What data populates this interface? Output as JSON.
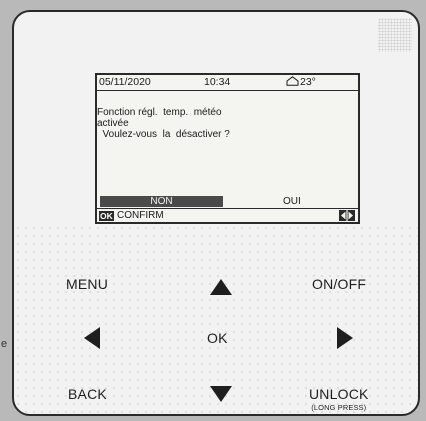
{
  "edge_text": "e",
  "lcd": {
    "status": {
      "date": "05/11/2020",
      "time": "10:34",
      "temperature": "23°"
    },
    "message": {
      "line1": "Fonction régl.  temp.  météo",
      "line2": "activée",
      "line3": "  Voulez-vous  la  désactiver ?"
    },
    "options": {
      "no_label": "NON",
      "yes_label": "OUI",
      "selected": "NON"
    },
    "footer": {
      "ok_badge": "OK",
      "confirm_label": "CONFIRM"
    }
  },
  "buttons": {
    "menu": "MENU",
    "on_off": "ON/OFF",
    "ok": "OK",
    "back": "BACK",
    "unlock": "UNLOCK",
    "unlock_sub": "(LONG PRESS)"
  },
  "icons": {
    "house": "house-icon",
    "nav": "left-right-arrows-icon",
    "up": "up-arrow-icon",
    "down": "down-arrow-icon",
    "left": "left-arrow-icon",
    "right": "right-arrow-icon"
  },
  "colors": {
    "panel": "#f2f2f2",
    "lcd_background": "#f4f4f0",
    "selected_option": "#4a4a4a",
    "outline": "#2a2a2a"
  }
}
